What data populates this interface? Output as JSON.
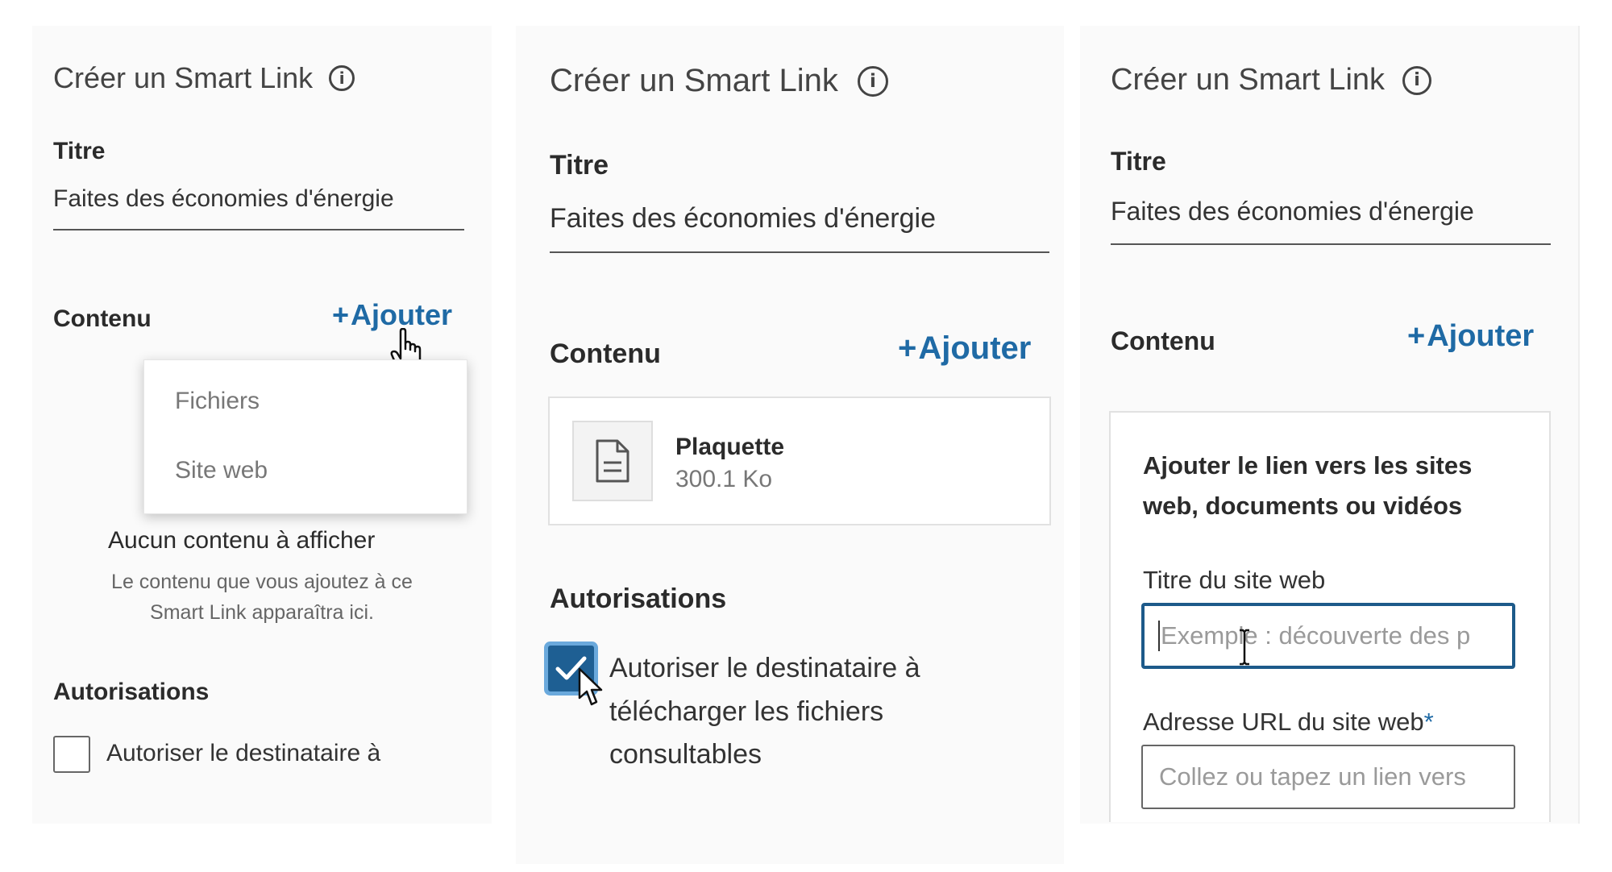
{
  "panels": [
    {
      "header": {
        "title": "Créer un Smart Link"
      },
      "title_label": "Titre",
      "title_value": "Faites des économies d'énergie",
      "content_label": "Contenu",
      "add_label": "Ajouter",
      "dropdown": {
        "items": [
          "Fichiers",
          "Site web"
        ]
      },
      "empty_title": "Aucun contenu à afficher",
      "empty_desc": [
        "Le contenu que vous ajoutez à ce",
        "Smart Link apparaîtra ici."
      ],
      "auth_label": "Autorisations",
      "checkbox": {
        "label": "Autoriser le destinataire à",
        "checked": false
      }
    },
    {
      "header": {
        "title": "Créer un Smart Link"
      },
      "title_label": "Titre",
      "title_value": "Faites des économies d'énergie",
      "content_label": "Contenu",
      "add_label": "Ajouter",
      "file": {
        "name": "Plaquette",
        "size": "300.1 Ko",
        "icon": "document-icon"
      },
      "auth_label": "Autorisations",
      "checkbox": {
        "label_lines": [
          "Autoriser le destinataire à",
          "télécharger les fichiers",
          "consultables"
        ],
        "checked": true
      }
    },
    {
      "header": {
        "title": "Créer un Smart Link"
      },
      "title_label": "Titre",
      "title_value": "Faites des économies d'énergie",
      "content_label": "Contenu",
      "add_label": "Ajouter",
      "link_box": {
        "heading_lines": [
          "Ajouter le lien vers les sites",
          "web, documents ou vidéos"
        ],
        "site_title_label": "Titre du site web",
        "site_title_placeholder": "Exemple : découverte des p",
        "url_label": "Adresse URL du site web",
        "url_required_mark": "*",
        "url_placeholder": "Collez ou tapez un lien vers"
      }
    }
  ],
  "colors": {
    "accent": "#1f6aa5",
    "checkbox_checked": "#1e5f93",
    "focus_border": "#1d5a8a",
    "required_star": "#1f6aa5"
  }
}
